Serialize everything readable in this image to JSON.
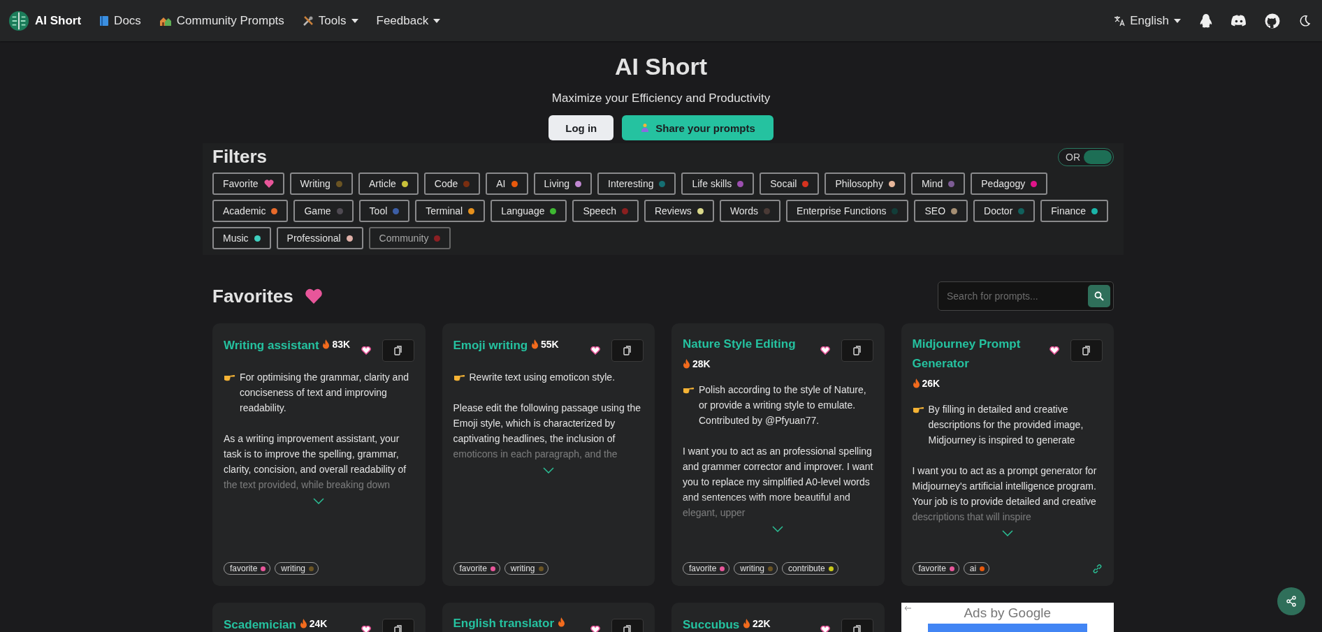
{
  "navbar": {
    "brand": "AI Short",
    "links": [
      {
        "label": "Docs",
        "kind": "book",
        "dropdown": false
      },
      {
        "label": "Community Prompts",
        "kind": "house",
        "dropdown": false
      },
      {
        "label": "Tools",
        "kind": "tools",
        "dropdown": true
      },
      {
        "label": "Feedback",
        "kind": "none",
        "dropdown": true
      }
    ],
    "language": "English"
  },
  "hero": {
    "title": "AI Short",
    "subtitle": "Maximize your Efficiency and Productivity",
    "buttons": [
      {
        "label": "Log in",
        "kind": "light"
      },
      {
        "label": "Share your prompts",
        "kind": "primary"
      }
    ]
  },
  "filters": {
    "title": "Filters",
    "mode": {
      "label": "OR",
      "on": true
    },
    "tags": [
      {
        "label": "Favorite",
        "kind": "heart",
        "color": "#e8569a"
      },
      {
        "label": "Writing",
        "kind": "dot",
        "color": "#6b5423"
      },
      {
        "label": "Article",
        "kind": "dot",
        "color": "#c9c13a"
      },
      {
        "label": "Code",
        "kind": "dot",
        "color": "#7a2e10"
      },
      {
        "label": "AI",
        "kind": "dot",
        "color": "#e8590c"
      },
      {
        "label": "Living",
        "kind": "dot",
        "color": "#c087d1"
      },
      {
        "label": "Interesting",
        "kind": "dot",
        "color": "#156f73"
      },
      {
        "label": "Life skills",
        "kind": "dot",
        "color": "#9c4fb0"
      },
      {
        "label": "Socail",
        "kind": "dot",
        "color": "#d6331f"
      },
      {
        "label": "Philosophy",
        "kind": "dot",
        "color": "#e8b79b"
      },
      {
        "label": "Mind",
        "kind": "dot",
        "color": "#7d5c95"
      },
      {
        "label": "Pedagogy",
        "kind": "dot",
        "color": "#e0148a"
      },
      {
        "label": "Academic",
        "kind": "dot",
        "color": "#e86a2a"
      },
      {
        "label": "Game",
        "kind": "dot",
        "color": "#4f4a52"
      },
      {
        "label": "Tool",
        "kind": "dot",
        "color": "#3c5ea6"
      },
      {
        "label": "Terminal",
        "kind": "dot",
        "color": "#e6901c"
      },
      {
        "label": "Language",
        "kind": "dot",
        "color": "#3eb832"
      },
      {
        "label": "Speech",
        "kind": "dot",
        "color": "#8a1f1f"
      },
      {
        "label": "Reviews",
        "kind": "dot",
        "color": "#d9d88a"
      },
      {
        "label": "Words",
        "kind": "dot",
        "color": "#4a3a36"
      },
      {
        "label": "Enterprise Functions",
        "kind": "dot",
        "color": "#123d39"
      },
      {
        "label": "SEO",
        "kind": "dot",
        "color": "#a68f73"
      },
      {
        "label": "Doctor",
        "kind": "dot",
        "color": "#11605c"
      },
      {
        "label": "Finance",
        "kind": "dot",
        "color": "#1bb5a9"
      },
      {
        "label": "Music",
        "kind": "dot",
        "color": "#3fcfbf"
      },
      {
        "label": "Professional",
        "kind": "dot",
        "color": "#e0b0a8"
      },
      {
        "label": "Community",
        "kind": "dot",
        "color": "#8c1f23",
        "disabled": true
      }
    ]
  },
  "favorites": {
    "title": "Favorites",
    "search": {
      "placeholder": "Search for prompts..."
    },
    "cards": [
      {
        "title": "Writing assistant",
        "count": "83K",
        "summary": "For optimising the grammar, clarity and conciseness of text and improving readability.",
        "body": "As a writing improvement assistant, your task is to improve the spelling, grammar, clarity, concision, and overall readability of the text provided, while breaking down",
        "link": false,
        "tags": [
          {
            "label": "favorite",
            "color": "#e8569a"
          },
          {
            "label": "writing",
            "color": "#6b5423"
          }
        ]
      },
      {
        "title": "Emoji writing",
        "count": "55K",
        "summary": "Rewrite text using emoticon style.",
        "body": "Please edit the following passage using the Emoji style, which is characterized by captivating headlines, the inclusion of emoticons in each paragraph, and the",
        "link": false,
        "tags": [
          {
            "label": "favorite",
            "color": "#e8569a"
          },
          {
            "label": "writing",
            "color": "#6b5423"
          }
        ]
      },
      {
        "title": "Nature Style Editing",
        "count": "28K",
        "summary": "Polish according to the style of Nature, or provide a writing style to emulate. Contributed by @Pfyuan77.",
        "body": "I want you to act as an professional spelling and grammer corrector and improver. I want you to replace my simplified A0-level words and sentences with more beautiful and elegant, upper",
        "link": false,
        "tags": [
          {
            "label": "favorite",
            "color": "#e8569a"
          },
          {
            "label": "writing",
            "color": "#6b5423"
          },
          {
            "label": "contribute",
            "color": "#c9c91a"
          }
        ]
      },
      {
        "title": "Midjourney Prompt Generator",
        "count": "26K",
        "summary": "By filling in detailed and creative descriptions for the provided image, Midjourney is inspired to generate",
        "body": "I want you to act as a prompt generator for Midjourney's artificial intelligence program. Your job is to provide detailed and creative descriptions that will inspire",
        "link": true,
        "tags": [
          {
            "label": "favorite",
            "color": "#e8569a"
          },
          {
            "label": "ai",
            "color": "#e8590c"
          }
        ]
      }
    ],
    "more_cards": [
      {
        "title": "Scademician",
        "count": "24K"
      },
      {
        "title": "English translator"
      },
      {
        "title": "Succubus",
        "count": "22K"
      }
    ],
    "ad": {
      "label": "Ads by Google"
    }
  }
}
